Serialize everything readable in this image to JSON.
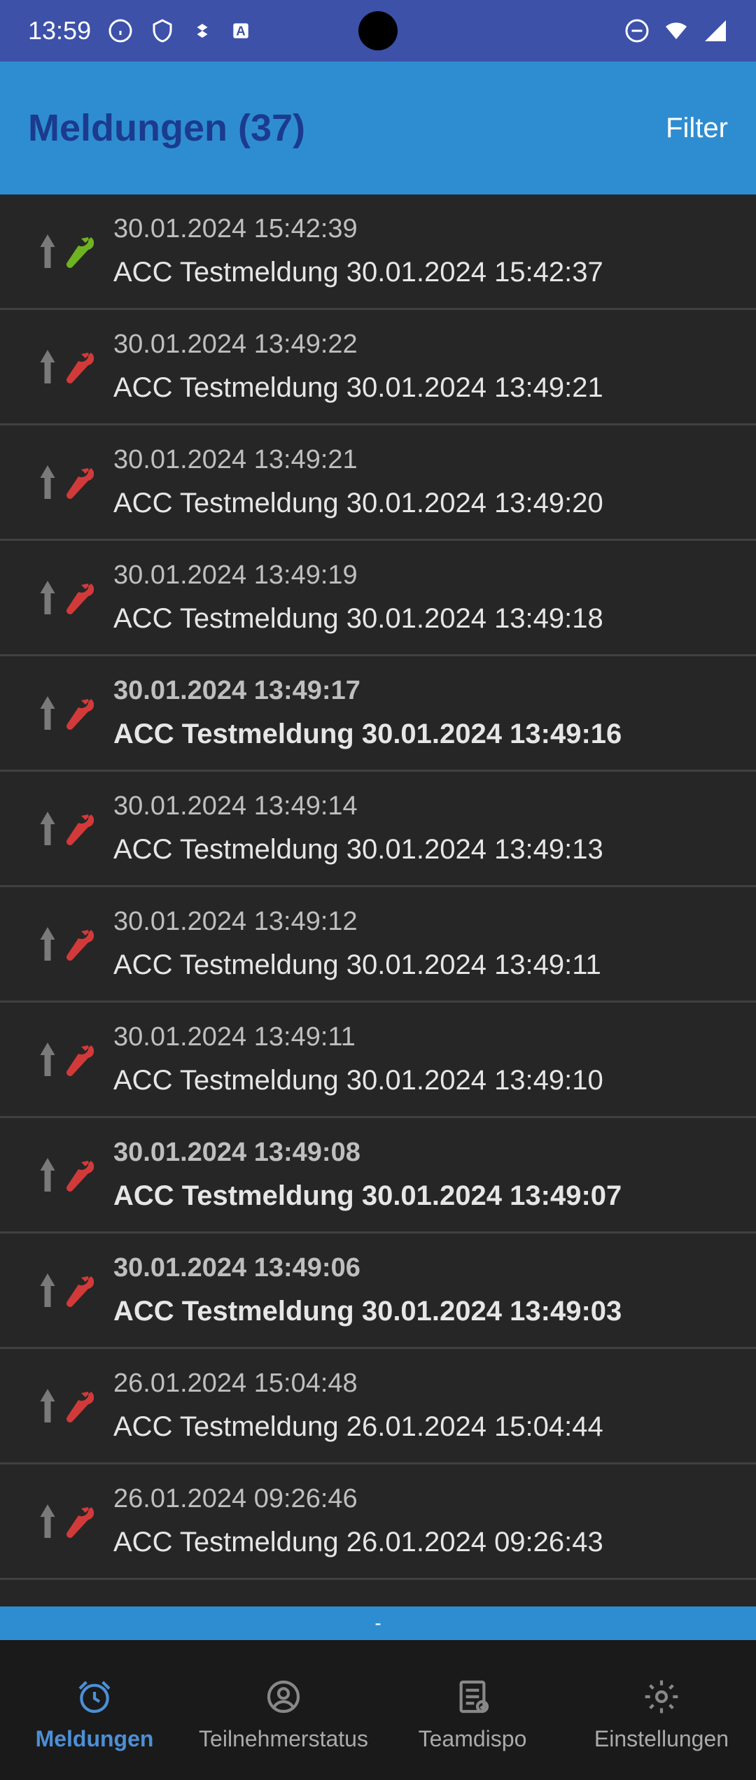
{
  "statusbar": {
    "time": "13:59"
  },
  "header": {
    "title": "Meldungen (37)",
    "filter_label": "Filter"
  },
  "items": [
    {
      "timestamp": "30.01.2024 15:42:39",
      "title": "ACC Testmeldung 30.01.2024 15:42:37",
      "wrench": "green",
      "bold": false
    },
    {
      "timestamp": "30.01.2024 13:49:22",
      "title": "ACC Testmeldung 30.01.2024 13:49:21",
      "wrench": "red",
      "bold": false
    },
    {
      "timestamp": "30.01.2024 13:49:21",
      "title": "ACC Testmeldung 30.01.2024 13:49:20",
      "wrench": "red",
      "bold": false
    },
    {
      "timestamp": "30.01.2024 13:49:19",
      "title": "ACC Testmeldung 30.01.2024 13:49:18",
      "wrench": "red",
      "bold": false
    },
    {
      "timestamp": "30.01.2024 13:49:17",
      "title": "ACC Testmeldung 30.01.2024 13:49:16",
      "wrench": "red",
      "bold": true
    },
    {
      "timestamp": "30.01.2024 13:49:14",
      "title": "ACC Testmeldung 30.01.2024 13:49:13",
      "wrench": "red",
      "bold": false
    },
    {
      "timestamp": "30.01.2024 13:49:12",
      "title": "ACC Testmeldung 30.01.2024 13:49:11",
      "wrench": "red",
      "bold": false
    },
    {
      "timestamp": "30.01.2024 13:49:11",
      "title": "ACC Testmeldung 30.01.2024 13:49:10",
      "wrench": "red",
      "bold": false
    },
    {
      "timestamp": "30.01.2024 13:49:08",
      "title": "ACC Testmeldung 30.01.2024 13:49:07",
      "wrench": "red",
      "bold": true
    },
    {
      "timestamp": "30.01.2024 13:49:06",
      "title": "ACC Testmeldung 30.01.2024 13:49:03",
      "wrench": "red",
      "bold": true
    },
    {
      "timestamp": "26.01.2024 15:04:48",
      "title": "ACC Testmeldung 26.01.2024 15:04:44",
      "wrench": "red",
      "bold": false
    },
    {
      "timestamp": "26.01.2024 09:26:46",
      "title": "ACC Testmeldung 26.01.2024 09:26:43",
      "wrench": "red",
      "bold": false
    }
  ],
  "footer": {
    "text": "-"
  },
  "nav": {
    "tabs": [
      {
        "label": "Meldungen",
        "active": true
      },
      {
        "label": "Teilnehmerstatus",
        "active": false
      },
      {
        "label": "Teamdispo",
        "active": false
      },
      {
        "label": "Einstellungen",
        "active": false
      }
    ]
  },
  "colors": {
    "wrench_green": "#6fb321",
    "wrench_red": "#d23a3a",
    "arrow_gray": "#7a7a7a"
  }
}
